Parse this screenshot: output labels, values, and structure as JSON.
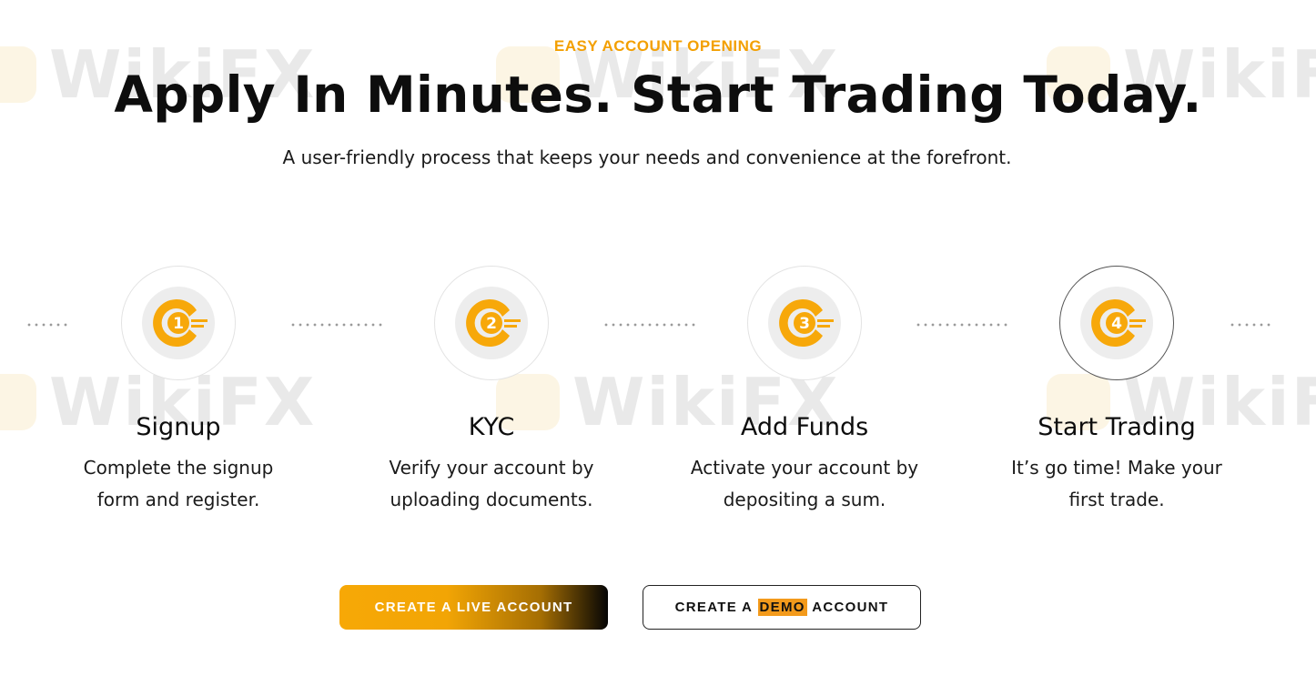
{
  "header": {
    "eyebrow": "EASY ACCOUNT OPENING",
    "title": "Apply In Minutes. Start Trading Today.",
    "subtitle": "A user-friendly process that keeps your needs and convenience at the forefront."
  },
  "steps": [
    {
      "number": "1",
      "title": "Signup",
      "desc_line1": "Complete the signup",
      "desc_line2": "form and register."
    },
    {
      "number": "2",
      "title": "KYC",
      "desc_line1": "Verify your account by",
      "desc_line2": "uploading documents."
    },
    {
      "number": "3",
      "title": "Add Funds",
      "desc_line1": "Activate your account by",
      "desc_line2": "depositing a sum."
    },
    {
      "number": "4",
      "title": "Start Trading",
      "desc_line1": "It’s go time! Make your",
      "desc_line2": "first trade."
    }
  ],
  "buttons": {
    "live": "CREATE A LIVE ACCOUNT",
    "demo_prefix": "CREATE A",
    "demo_highlight": "DEMO",
    "demo_suffix": "ACCOUNT"
  },
  "watermark": {
    "text": "WikiFX"
  },
  "colors": {
    "accent": "#f3a003",
    "text": "#0d0d0d",
    "highlight": "#f39a1b"
  },
  "icons": {
    "step_icon": "orange-c-logo-icon",
    "connector": "dotted-line"
  }
}
